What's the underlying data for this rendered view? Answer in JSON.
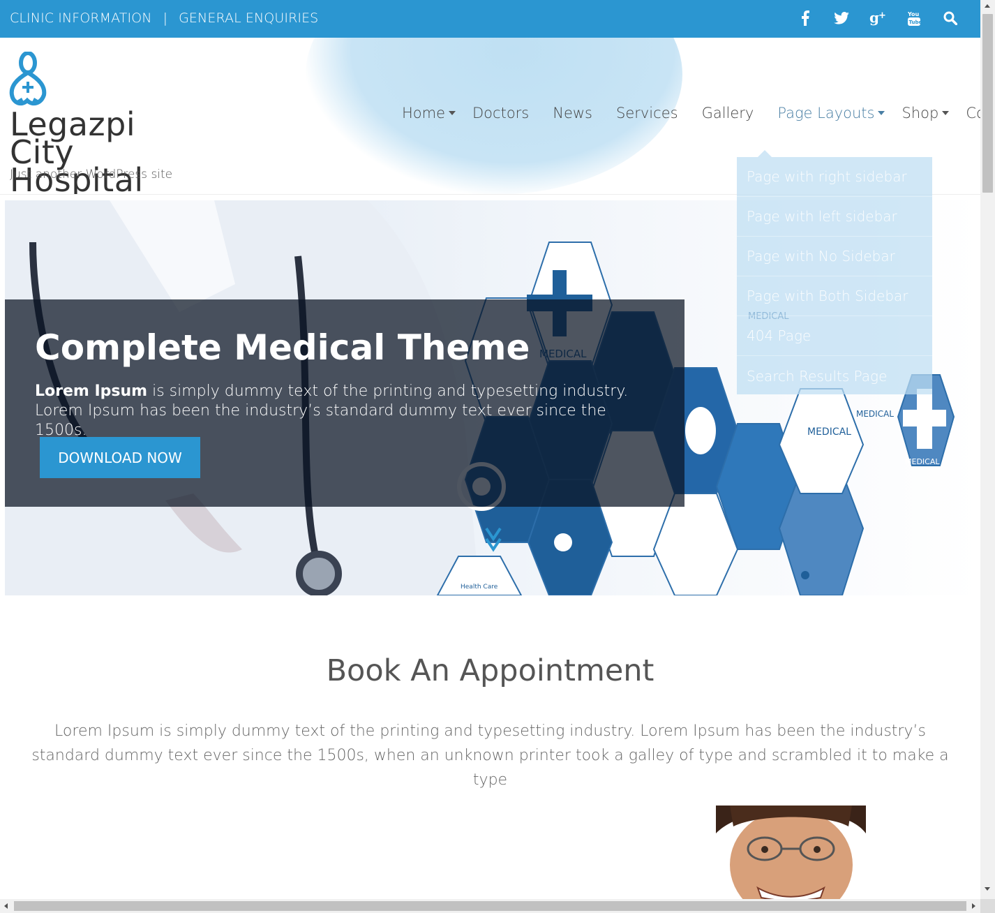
{
  "topbar": {
    "link_1": "CLINIC INFORMATION",
    "separator": "|",
    "link_2": "GENERAL ENQUIRIES",
    "social": [
      {
        "icon": "facebook-icon",
        "glyph": "f"
      },
      {
        "icon": "twitter-icon",
        "glyph": "t"
      },
      {
        "icon": "google-plus-icon",
        "glyph": "g+"
      },
      {
        "icon": "youtube-icon",
        "glyph": "You Tube"
      },
      {
        "icon": "search-icon",
        "glyph": ""
      }
    ],
    "background": "#2b96d1"
  },
  "site": {
    "title": "Legazpi City Hospital",
    "tagline": "Just another WordPress site"
  },
  "nav": {
    "items": [
      {
        "label": "Home",
        "dropdown": true
      },
      {
        "label": "Doctors",
        "dropdown": false
      },
      {
        "label": "News",
        "dropdown": false
      },
      {
        "label": "Services",
        "dropdown": false
      },
      {
        "label": "Gallery",
        "dropdown": false
      },
      {
        "label": "Page Layouts",
        "dropdown": true
      },
      {
        "label": "Shop",
        "dropdown": true
      },
      {
        "label": "Contact",
        "dropdown": false
      }
    ],
    "active_item": "Page Layouts"
  },
  "dropdown": {
    "items": [
      "Page with right sidebar",
      "Page with left sidebar",
      "Page with No Sidebar",
      "Page with Both Sidebar",
      "404 Page",
      "Search Results Page"
    ]
  },
  "slider": {
    "heading": "Complete Medical Theme",
    "text_bold": "Lorem Ipsum",
    "text_rest": " is simply dummy text of the printing and typesetting industry. Lorem Ipsum has been the industry’s standard dummy text ever since the 1500s.",
    "button": "DOWNLOAD NOW",
    "hex_labels": [
      "MEDICAL",
      "MEDICAL",
      "MEDICAL",
      "MEDICAL",
      "MEDICAL",
      "MEDICAL",
      "Health Care"
    ]
  },
  "appointment": {
    "title": "Book An Appointment",
    "text": "Lorem Ipsum is simply dummy text of the printing and typesetting industry. Lorem Ipsum has been the industry’s standard dummy text ever since the 1500s, when an unknown printer took a galley of type and scrambled it to make a type"
  },
  "colors": {
    "accent": "#2b96d1",
    "hex_dark": "#1f5f99",
    "hex_light": "#4f88c1"
  }
}
